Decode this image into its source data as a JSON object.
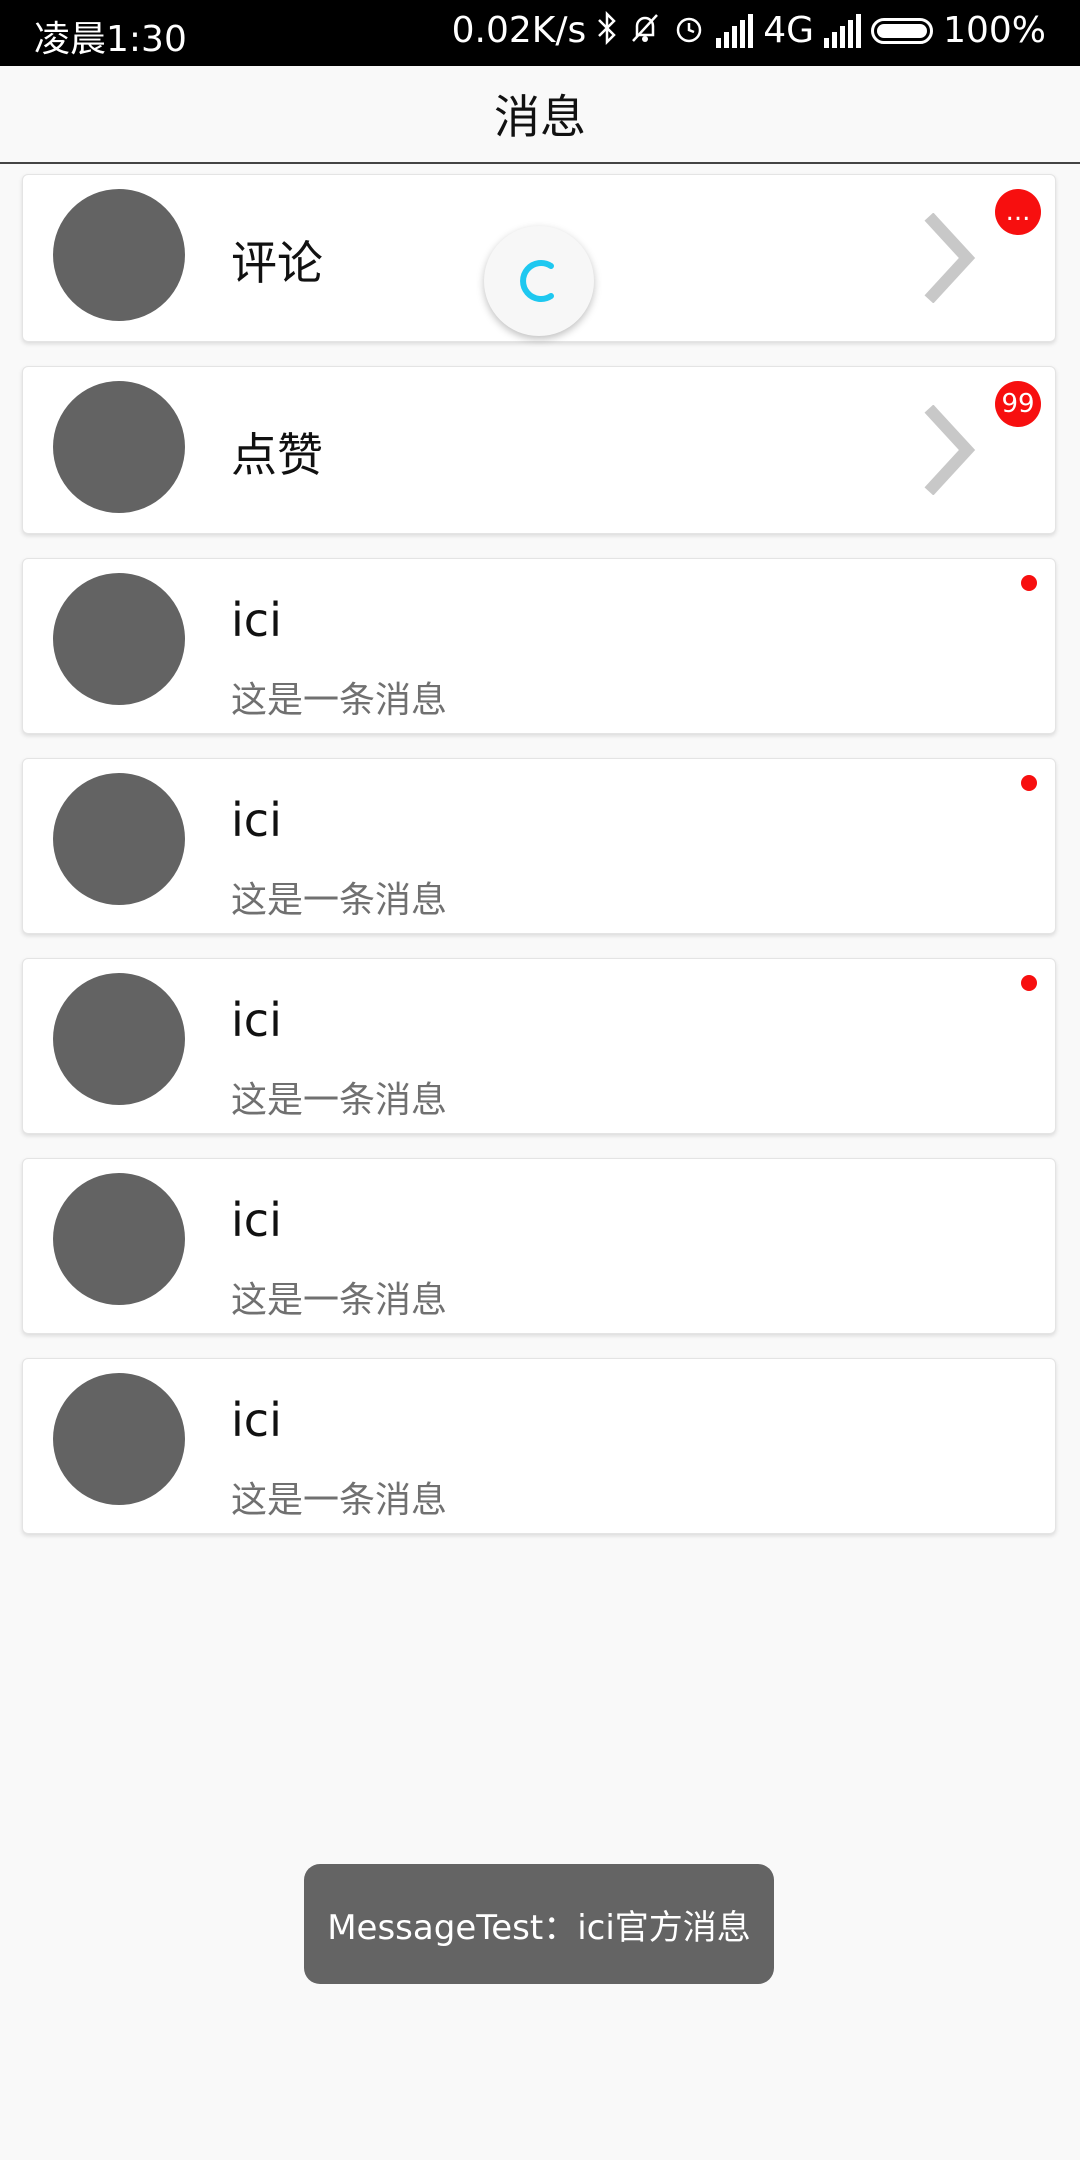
{
  "status_bar": {
    "time": "凌晨1:30",
    "net_speed": "0.02K/s",
    "network_type": "4G",
    "battery": "100%"
  },
  "header": {
    "title": "消息"
  },
  "items": [
    {
      "title": "评论",
      "badge": "..."
    },
    {
      "title": "点赞",
      "badge": "99"
    },
    {
      "name": "ici",
      "message": "这是一条消息",
      "unread": true
    },
    {
      "name": "ici",
      "message": "这是一条消息",
      "unread": true
    },
    {
      "name": "ici",
      "message": "这是一条消息",
      "unread": true
    },
    {
      "name": "ici",
      "message": "这是一条消息",
      "unread": false
    },
    {
      "name": "ici",
      "message": "这是一条消息",
      "unread": false
    }
  ],
  "toast": {
    "text": "MessageTest：ici官方消息"
  },
  "colors": {
    "badge": "#f70f0f",
    "avatar": "#636363",
    "spinner": "#1ec8f0"
  }
}
